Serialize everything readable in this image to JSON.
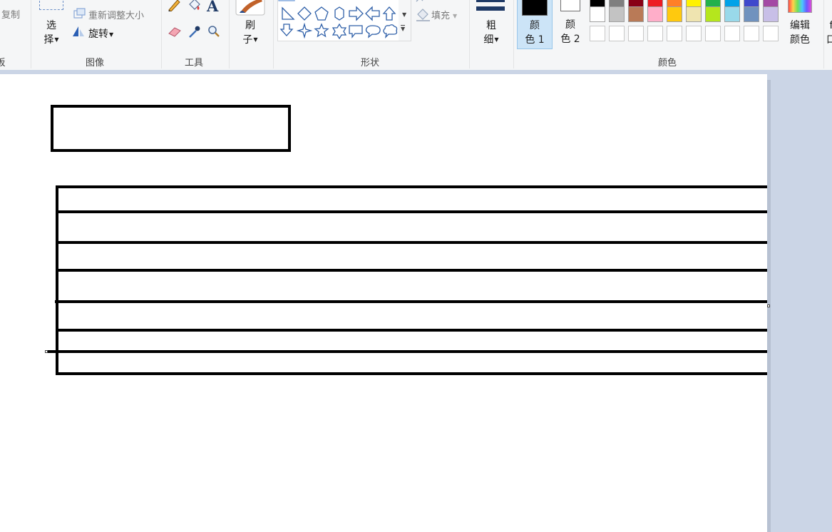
{
  "ribbon": {
    "clipboard": {
      "copy_label": "复制",
      "group_label_partial": "板"
    },
    "image": {
      "select_label_line1": "选",
      "select_label_line2": "择",
      "resize_label": "重新调整大小",
      "rotate_label": "旋转",
      "group_label": "图像"
    },
    "tools": {
      "group_label": "工具",
      "text_glyph": "A"
    },
    "brushes": {
      "label_line1": "刷",
      "label_line2": "子"
    },
    "shapes": {
      "fill_label": "填充",
      "group_label": "形状",
      "gallery_icons": [
        "right-triangle-icon",
        "diamond-icon",
        "pentagon-icon",
        "hexagon-icon",
        "right-arrow-icon",
        "left-arrow-icon",
        "up-arrow-icon",
        "down-arrow-icon",
        "four-point-star-icon",
        "five-point-star-icon",
        "six-point-star-icon",
        "rect-callout-icon",
        "oval-callout-icon",
        "cloud-callout-icon"
      ]
    },
    "size": {
      "label_line1": "粗",
      "label_line2": "细"
    },
    "colors": {
      "color1_line1": "颜",
      "color1_line2": "色 1",
      "color2_line1": "颜",
      "color2_line2": "色 2",
      "edit_line1": "编辑",
      "edit_line2": "颜色",
      "group_label": "颜色",
      "color1_value": "#000000",
      "color2_value": "#ffffff",
      "palette_row1": [
        "#000000",
        "#7f7f7f",
        "#880015",
        "#ed1c24",
        "#ff7f27",
        "#fff200",
        "#22b14c",
        "#00a2e8",
        "#3f48cc",
        "#a349a4"
      ],
      "palette_row2": [
        "#ffffff",
        "#c3c3c3",
        "#b97a57",
        "#ffaec9",
        "#ffc90e",
        "#efe4b0",
        "#b5e61d",
        "#99d9ea",
        "#7092be",
        "#c8bfe7"
      ]
    },
    "partial_next": {
      "line1": "f",
      "line2": "口"
    }
  }
}
